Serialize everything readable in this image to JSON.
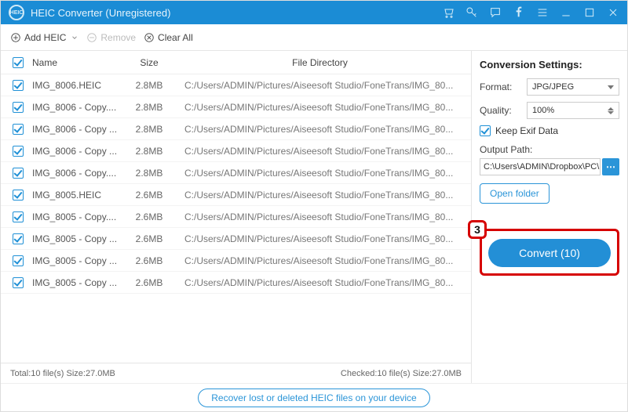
{
  "titlebar": {
    "title": "HEIC Converter (Unregistered)"
  },
  "toolbar": {
    "add_label": "Add HEIC",
    "remove_label": "Remove",
    "clear_label": "Clear All"
  },
  "columns": {
    "name": "Name",
    "size": "Size",
    "dir": "File Directory"
  },
  "files": [
    {
      "name": "IMG_8006.HEIC",
      "size": "2.8MB",
      "dir": "C:/Users/ADMIN/Pictures/Aiseesoft Studio/FoneTrans/IMG_80..."
    },
    {
      "name": "IMG_8006 - Copy....",
      "size": "2.8MB",
      "dir": "C:/Users/ADMIN/Pictures/Aiseesoft Studio/FoneTrans/IMG_80..."
    },
    {
      "name": "IMG_8006 - Copy ...",
      "size": "2.8MB",
      "dir": "C:/Users/ADMIN/Pictures/Aiseesoft Studio/FoneTrans/IMG_80..."
    },
    {
      "name": "IMG_8006 - Copy ...",
      "size": "2.8MB",
      "dir": "C:/Users/ADMIN/Pictures/Aiseesoft Studio/FoneTrans/IMG_80..."
    },
    {
      "name": "IMG_8006 - Copy....",
      "size": "2.8MB",
      "dir": "C:/Users/ADMIN/Pictures/Aiseesoft Studio/FoneTrans/IMG_80..."
    },
    {
      "name": "IMG_8005.HEIC",
      "size": "2.6MB",
      "dir": "C:/Users/ADMIN/Pictures/Aiseesoft Studio/FoneTrans/IMG_80..."
    },
    {
      "name": "IMG_8005 - Copy....",
      "size": "2.6MB",
      "dir": "C:/Users/ADMIN/Pictures/Aiseesoft Studio/FoneTrans/IMG_80..."
    },
    {
      "name": "IMG_8005 - Copy ...",
      "size": "2.6MB",
      "dir": "C:/Users/ADMIN/Pictures/Aiseesoft Studio/FoneTrans/IMG_80..."
    },
    {
      "name": "IMG_8005 - Copy ...",
      "size": "2.6MB",
      "dir": "C:/Users/ADMIN/Pictures/Aiseesoft Studio/FoneTrans/IMG_80..."
    },
    {
      "name": "IMG_8005 - Copy ...",
      "size": "2.6MB",
      "dir": "C:/Users/ADMIN/Pictures/Aiseesoft Studio/FoneTrans/IMG_80..."
    }
  ],
  "status": {
    "total": "Total:10 file(s) Size:27.0MB",
    "checked": "Checked:10 file(s) Size:27.0MB"
  },
  "settings": {
    "title": "Conversion Settings:",
    "format_label": "Format:",
    "format_value": "JPG/JPEG",
    "quality_label": "Quality:",
    "quality_value": "100%",
    "keep_exif_label": "Keep Exif Data",
    "output_path_label": "Output Path:",
    "output_path_value": "C:\\Users\\ADMIN\\Dropbox\\PC\\",
    "open_folder_label": "Open folder",
    "convert_label": "Convert (10)",
    "step_badge": "3"
  },
  "footer": {
    "recover_label": "Recover lost or deleted HEIC files on your device"
  }
}
